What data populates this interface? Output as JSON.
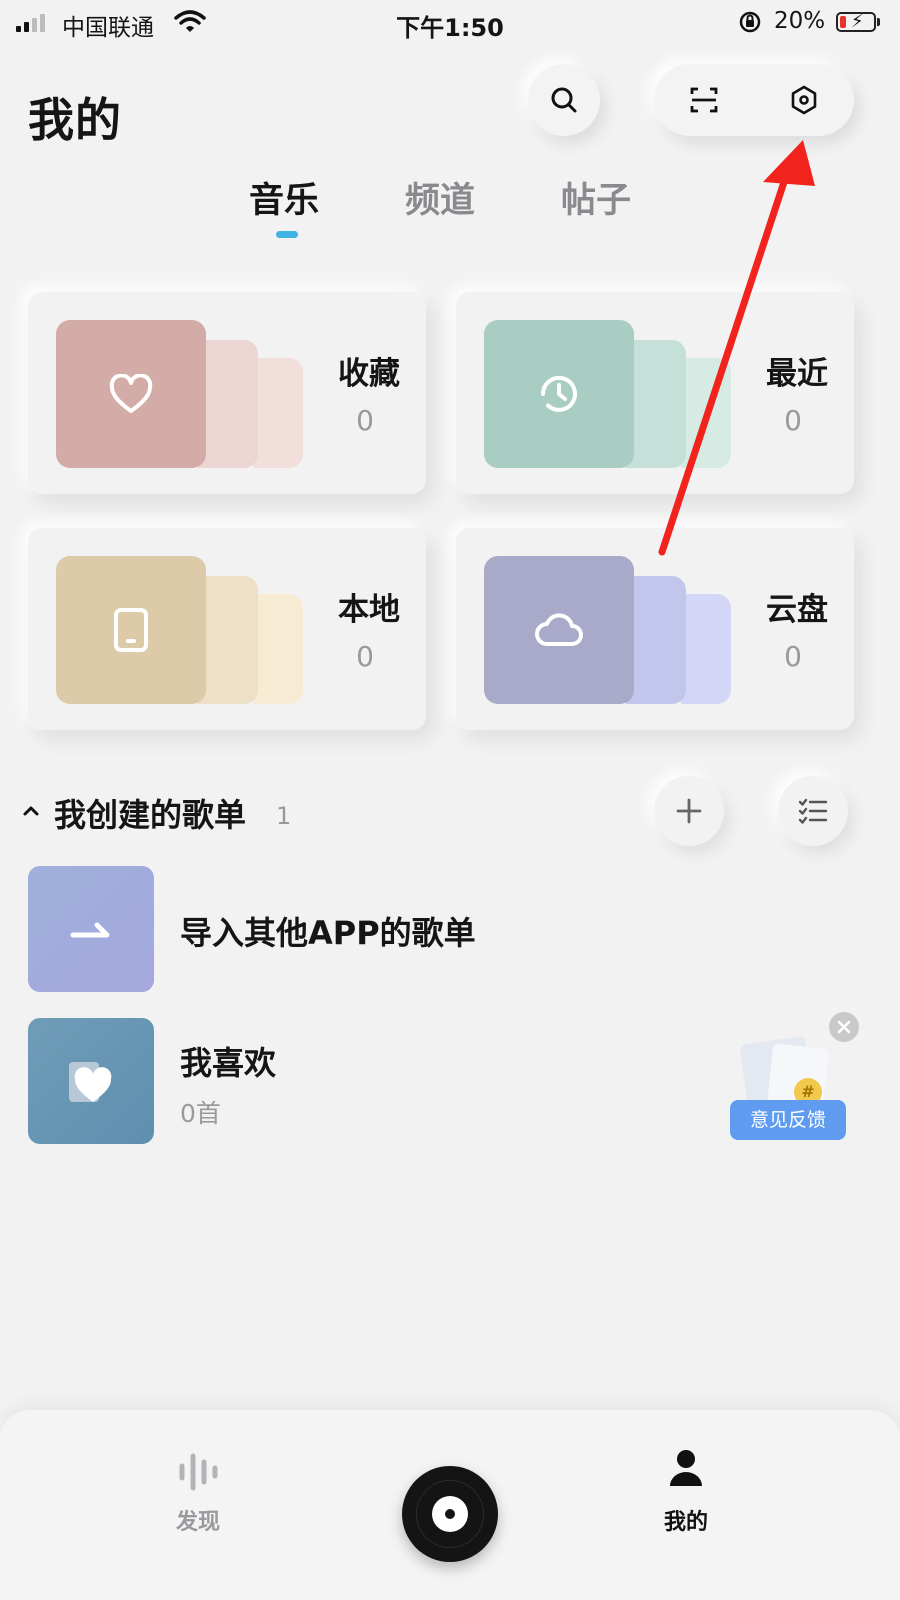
{
  "status_bar": {
    "carrier": "中国联通",
    "time": "下午1:50",
    "battery_percent": "20%",
    "battery_level": 0.2,
    "battery_color": "#e8332c"
  },
  "header": {
    "title": "我的",
    "icons": [
      "search-icon",
      "scan-icon",
      "settings-icon"
    ]
  },
  "tabs": [
    {
      "label": "音乐",
      "active": true
    },
    {
      "label": "频道",
      "active": false
    },
    {
      "label": "帖子",
      "active": false
    }
  ],
  "accent_color": "#3fb3e3",
  "cards": [
    {
      "label": "收藏",
      "count": "0",
      "icon": "heart-icon",
      "colors": [
        "#d3aca7",
        "#ecd5d2",
        "#f2dfdc"
      ]
    },
    {
      "label": "最近",
      "count": "0",
      "icon": "clock-icon",
      "colors": [
        "#a9cdc3",
        "#c5e0d8",
        "#d6ebe4"
      ]
    },
    {
      "label": "本地",
      "count": "0",
      "icon": "phone-icon",
      "colors": [
        "#dccaa8",
        "#eee0c7",
        "#f8ebd3"
      ]
    },
    {
      "label": "云盘",
      "count": "0",
      "icon": "cloud-icon",
      "colors": [
        "#a9aac9",
        "#c3c6ec",
        "#d3d6f6"
      ]
    }
  ],
  "playlists_section": {
    "title": "我创建的歌单",
    "count": "1",
    "icons": [
      "chevron-up-icon",
      "plus-icon",
      "list-manage-icon"
    ]
  },
  "playlists": [
    {
      "title": "导入其他APP的歌单",
      "subtitle": "",
      "icon": "import-arrow-icon",
      "cover_colors": [
        "#9fb0dc",
        "#a4a8dc"
      ]
    },
    {
      "title": "我喜欢",
      "subtitle": "0首",
      "icon": "heart-icon",
      "cover_colors": [
        "#6f9db7",
        "#5f8fb0"
      ]
    }
  ],
  "feedback_badge": {
    "label": "意见反馈",
    "coin": "#"
  },
  "bottom_nav": [
    {
      "label": "发现",
      "icon": "waveform-icon",
      "active": false
    },
    {
      "label": "",
      "icon": "vinyl-disc-icon",
      "active": false
    },
    {
      "label": "我的",
      "icon": "user-icon",
      "active": true
    }
  ],
  "annotation": {
    "arrow_color": "#f2221d",
    "target": "settings-icon"
  }
}
